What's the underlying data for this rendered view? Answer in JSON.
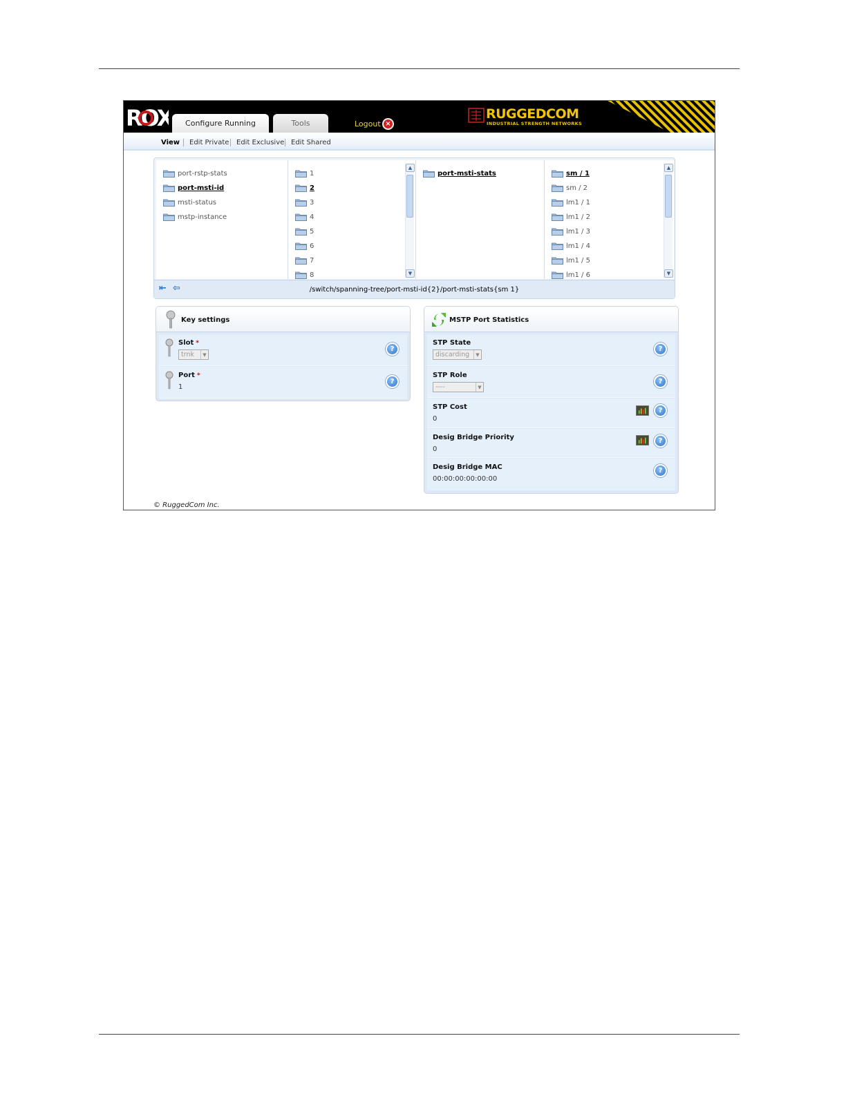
{
  "app": {
    "logo_text": "ROX",
    "brand_name": "RUGGEDCOM",
    "brand_tagline": "INDUSTRIAL STRENGTH NETWORKS"
  },
  "tabs": [
    {
      "label": "Configure Running",
      "active": true
    },
    {
      "label": "Tools",
      "active": false
    }
  ],
  "logout": {
    "label": "Logout"
  },
  "modes": [
    "View",
    "Edit Private",
    "Edit Exclusive",
    "Edit Shared"
  ],
  "browser": {
    "col1": [
      "port-rstp-stats",
      "port-msti-id",
      "msti-status",
      "mstp-instance"
    ],
    "col1_selected": "port-msti-id",
    "col2": [
      "1",
      "2",
      "3",
      "4",
      "5",
      "6",
      "7",
      "8"
    ],
    "col2_selected": "2",
    "col3": [
      "port-msti-stats"
    ],
    "col3_selected": "port-msti-stats",
    "col4": [
      "sm / 1",
      "sm / 2",
      "lm1 / 1",
      "lm1 / 2",
      "lm1 / 3",
      "lm1 / 4",
      "lm1 / 5",
      "lm1 / 6"
    ],
    "col4_selected": "sm / 1",
    "path": "/switch/spanning-tree/port-msti-id{2}/port-msti-stats{sm 1}"
  },
  "key_settings": {
    "title": "Key settings",
    "slot": {
      "label": "Slot",
      "required": "*",
      "value": "trnk"
    },
    "port": {
      "label": "Port",
      "required": "*",
      "value": "1"
    }
  },
  "mstp_stats": {
    "title": "MSTP Port Statistics",
    "stp_state": {
      "label": "STP State",
      "value": "discarding"
    },
    "stp_role": {
      "label": "STP Role",
      "value": "----"
    },
    "stp_cost": {
      "label": "STP Cost",
      "value": "0"
    },
    "desig_bridge_priority": {
      "label": "Desig Bridge Priority",
      "value": "0"
    },
    "desig_bridge_mac": {
      "label": "Desig Bridge MAC",
      "value": "00:00:00:00:00:00"
    }
  },
  "footer": {
    "copyright": "© RuggedCom Inc."
  },
  "colors": {
    "brand": "#f2c500",
    "panel_bg": "#dde9f6",
    "help_blue": "#2a73c9",
    "logout_red": "#d52020"
  },
  "icons": [
    "folder-icon",
    "scroll-up-icon",
    "scroll-down-icon",
    "nav-first-icon",
    "nav-back-icon",
    "key-icon",
    "refresh-icon",
    "help-icon",
    "chart-icon",
    "close-icon"
  ]
}
